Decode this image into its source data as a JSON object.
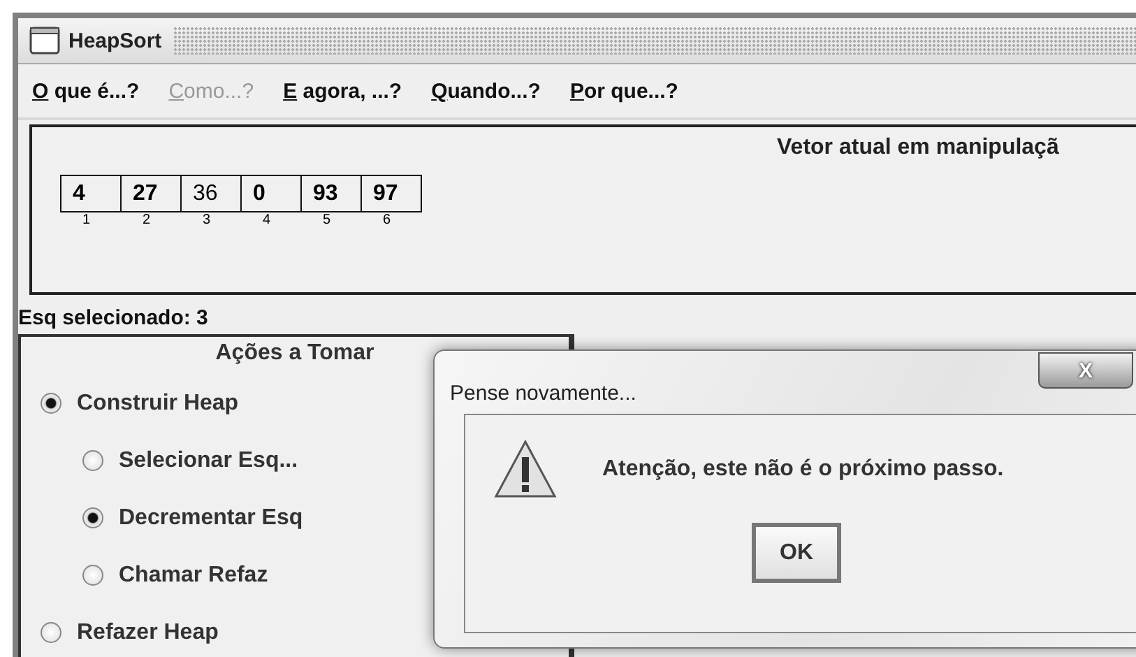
{
  "window": {
    "title": "HeapSort"
  },
  "menu": [
    {
      "label": "O que é...?",
      "disabled": false
    },
    {
      "label": "Como...?",
      "disabled": true
    },
    {
      "label": "E agora, ...?",
      "disabled": false
    },
    {
      "label": "Quando...?",
      "disabled": false
    },
    {
      "label": "Por que...?",
      "disabled": false
    }
  ],
  "array_panel": {
    "heading": "Vetor atual em manipulaçã",
    "cells": [
      {
        "value": "4",
        "index": "1",
        "selected": false
      },
      {
        "value": "27",
        "index": "2",
        "selected": false
      },
      {
        "value": "36",
        "index": "3",
        "selected": true
      },
      {
        "value": "0",
        "index": "4",
        "selected": false
      },
      {
        "value": "93",
        "index": "5",
        "selected": false
      },
      {
        "value": "97",
        "index": "6",
        "selected": false
      }
    ]
  },
  "status_label": "Esq selecionado: 3",
  "actions": {
    "title": "Ações a Tomar",
    "options": [
      {
        "label": "Construir Heap",
        "selected": true,
        "children": [
          {
            "label": "Selecionar Esq...",
            "selected": false
          },
          {
            "label": "Decrementar Esq",
            "selected": true
          },
          {
            "label": "Chamar Refaz",
            "selected": false
          }
        ]
      },
      {
        "label": "Refazer Heap",
        "selected": false
      }
    ]
  },
  "dialog": {
    "title": "Pense novamente...",
    "close": "X",
    "message": "Atenção, este não é o próximo passo.",
    "button": "OK"
  }
}
